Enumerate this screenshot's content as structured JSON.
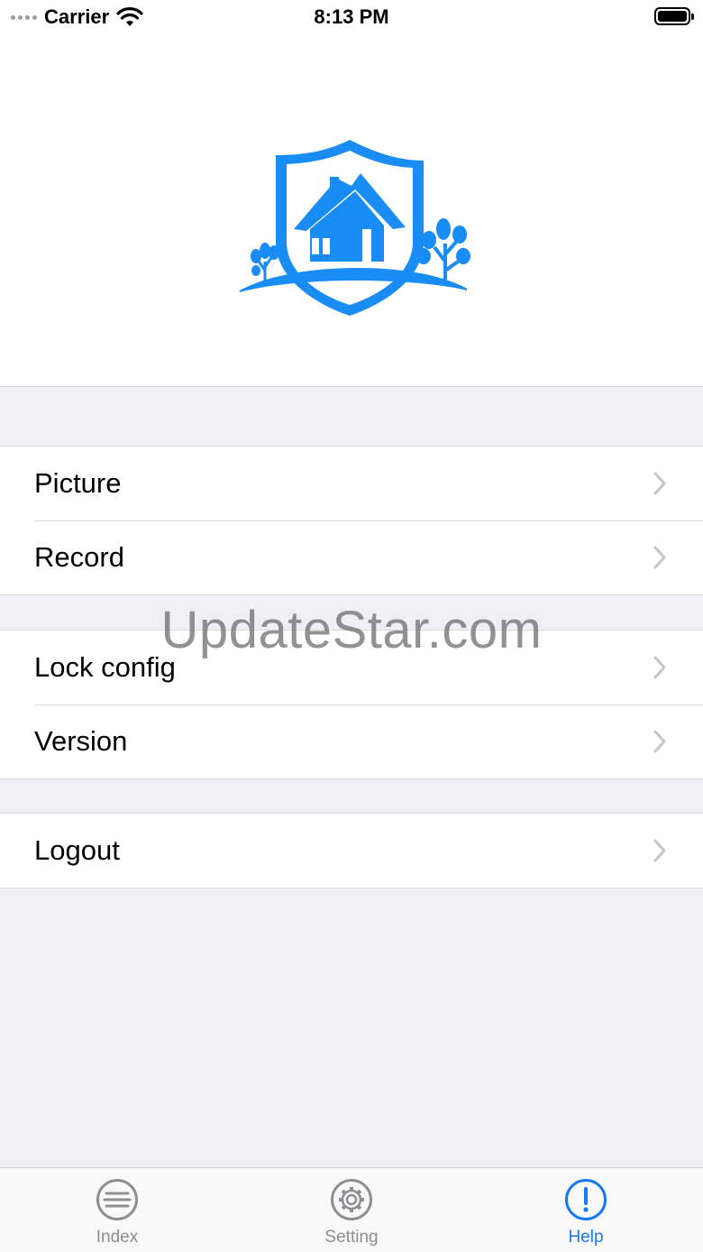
{
  "status_bar": {
    "carrier": "Carrier",
    "time": "8:13 PM"
  },
  "logo": {
    "icon": "house-shield-logo",
    "color": "#1a8cf5"
  },
  "menu_groups": [
    {
      "items": [
        {
          "label": "Picture",
          "icon": "chevron-right-icon"
        },
        {
          "label": "Record",
          "icon": "chevron-right-icon"
        }
      ]
    },
    {
      "items": [
        {
          "label": "Lock config",
          "icon": "chevron-right-icon"
        },
        {
          "label": "Version",
          "icon": "chevron-right-icon"
        }
      ]
    },
    {
      "items": [
        {
          "label": "Logout",
          "icon": "chevron-right-icon"
        }
      ]
    }
  ],
  "watermark": "UpdateStar.com",
  "tab_bar": {
    "tabs": [
      {
        "label": "Index",
        "icon": "menu-lines-icon",
        "active": false
      },
      {
        "label": "Setting",
        "icon": "gear-icon",
        "active": false
      },
      {
        "label": "Help",
        "icon": "exclamation-circle-icon",
        "active": true
      }
    ],
    "active_color": "#1877f2",
    "inactive_color": "#8e8e93"
  }
}
